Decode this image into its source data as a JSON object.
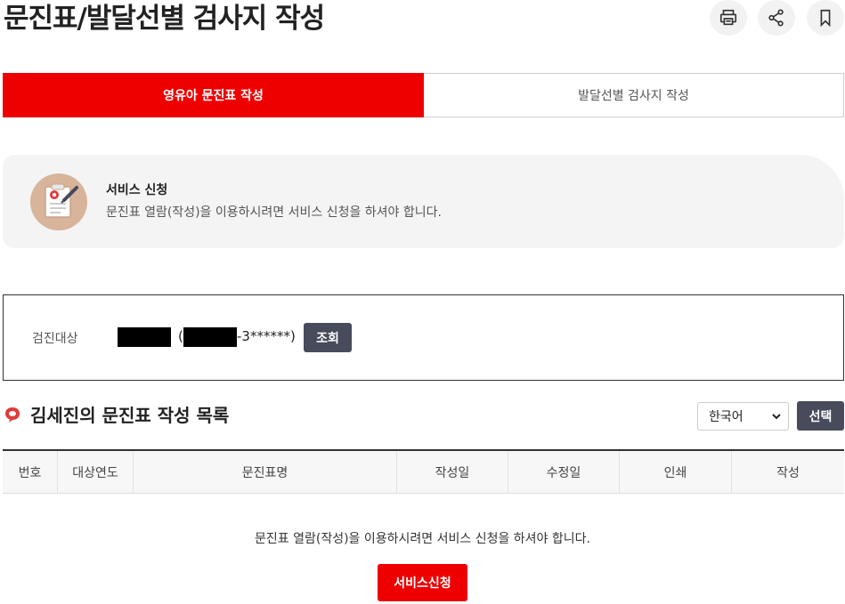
{
  "page": {
    "title": "문진표/발달선별 검사지 작성"
  },
  "toolbar": {
    "print_icon": "printer-icon",
    "share_icon": "share-icon",
    "bookmark_icon": "bookmark-icon"
  },
  "tabs": [
    {
      "label": "영유아 문진표 작성",
      "active": true
    },
    {
      "label": "발달선별 검사지 작성",
      "active": false
    }
  ],
  "notice": {
    "title": "서비스 신청",
    "description": "문진표 열람(작성)을 이용하시려면 서비스 신청을 하셔야 합니다."
  },
  "search": {
    "label": "검진대상",
    "paren_open": "(",
    "masked_suffix": "-3******)",
    "query_button": "조회"
  },
  "list": {
    "title": "김세진의 문진표 작성 목록",
    "language_selected": "한국어",
    "select_button": "선택",
    "columns": [
      "번호",
      "대상연도",
      "문진표명",
      "작성일",
      "수정일",
      "인쇄",
      "작성"
    ],
    "empty_message": "문진표 열람(작성)을 이용하시려면 서비스 신청을 하셔야 합니다.",
    "apply_button": "서비스신청"
  },
  "colors": {
    "accent": "#ee0000",
    "dark_button": "#484b5c",
    "notice_bg": "#f4f4f4"
  }
}
